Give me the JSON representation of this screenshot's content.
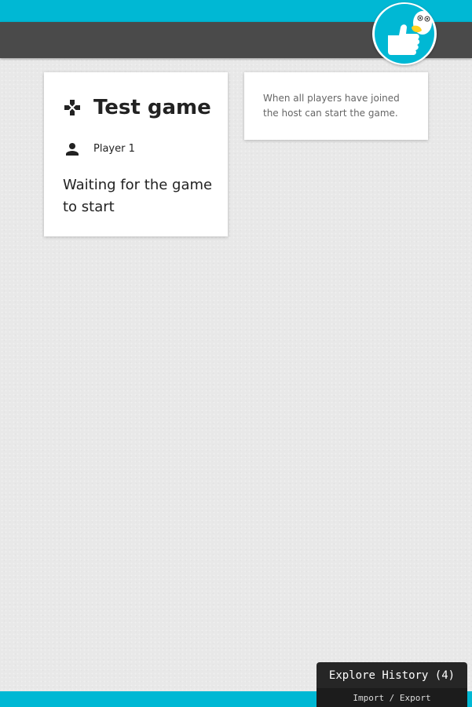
{
  "colors": {
    "accent": "#00b8d4",
    "navbar": "#4a4a4a",
    "background": "#e8e8e8",
    "text": "#222222",
    "muted_text": "#666666"
  },
  "header": {
    "logo_icon": "duck-thumbs-up-icon"
  },
  "game_card": {
    "icon": "gamepad-icon",
    "title": "Test game",
    "player_icon": "person-icon",
    "player_name": "Player 1",
    "status": "Waiting for the game to start"
  },
  "info_card": {
    "text": "When all players have joined the host can start the game."
  },
  "history_panel": {
    "button_label": "Explore History (4)",
    "sub_label": "Import / Export"
  }
}
